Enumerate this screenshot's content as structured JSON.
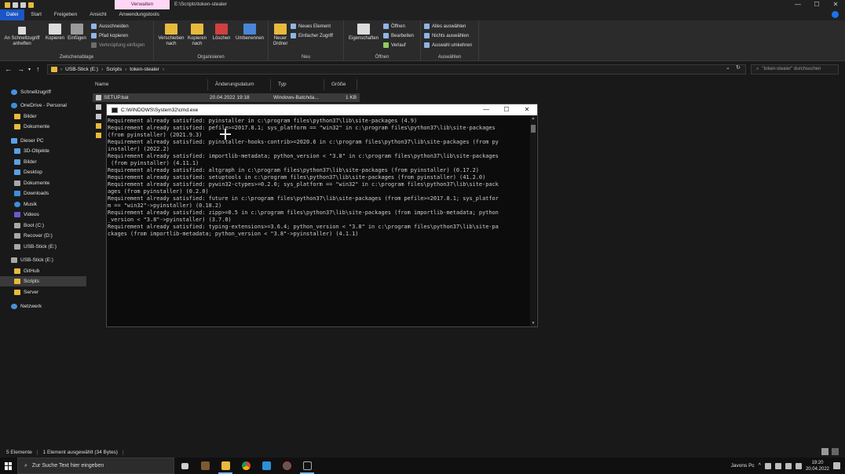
{
  "titlebar": {
    "context_tab": "Verwalten",
    "path": "E:\\Scripts\\token-stealer",
    "min": "—",
    "max": "☐",
    "close": "✕"
  },
  "ribbon_tabs": [
    "Datei",
    "Start",
    "Freigeben",
    "Ansicht",
    "Anwendungstools"
  ],
  "ribbon": {
    "clipboard": {
      "label": "Zwischenablage",
      "pin": "An Schnellzugriff anheften",
      "copy": "Kopieren",
      "paste": "Einfügen",
      "cut": "Ausschneiden",
      "copy_path": "Pfad kopieren",
      "paste_shortcut": "Verknüpfung einfügen"
    },
    "organize": {
      "label": "Organisieren",
      "move_to": "Verschieben nach",
      "copy_to": "Kopieren nach",
      "delete": "Löschen",
      "rename": "Umbenennen"
    },
    "new": {
      "label": "Neu",
      "new_folder": "Neuer Ordner",
      "new_item": "Neues Element",
      "easy_access": "Einfacher Zugriff"
    },
    "open": {
      "label": "Öffnen",
      "properties": "Eigenschaften",
      "open": "Öffnen",
      "edit": "Bearbeiten",
      "history": "Verlauf"
    },
    "select": {
      "label": "Auswählen",
      "select_all": "Alles auswählen",
      "select_none": "Nichts auswählen",
      "invert": "Auswahl umkehren"
    }
  },
  "address": {
    "crumbs": [
      "USB-Stick (E:)",
      "Scripts",
      "token-stealer"
    ],
    "search_placeholder": "\"token-stealer\" durchsuchen"
  },
  "nav": [
    {
      "label": "Schnellzugriff",
      "icon": "star-icon"
    },
    {
      "label": "OneDrive - Personal",
      "icon": "cloud-icon"
    },
    {
      "label": "Bilder",
      "icon": "folder-icon"
    },
    {
      "label": "Dokumente",
      "icon": "folder-icon"
    },
    {
      "label": "Dieser PC",
      "icon": "pc-icon"
    },
    {
      "label": "3D-Objekte",
      "icon": "cube-icon"
    },
    {
      "label": "Bilder",
      "icon": "pictures-icon"
    },
    {
      "label": "Desktop",
      "icon": "desktop-icon"
    },
    {
      "label": "Dokumente",
      "icon": "documents-icon"
    },
    {
      "label": "Downloads",
      "icon": "download-icon"
    },
    {
      "label": "Musik",
      "icon": "music-icon"
    },
    {
      "label": "Videos",
      "icon": "video-icon"
    },
    {
      "label": "Boot (C:)",
      "icon": "drive-icon"
    },
    {
      "label": "Recover (D:)",
      "icon": "drive-icon"
    },
    {
      "label": "USB-Stick (E:)",
      "icon": "usb-drive-icon"
    },
    {
      "label": "USB-Stick (E:)",
      "icon": "usb-drive-icon"
    },
    {
      "label": "GitHub",
      "icon": "folder-icon"
    },
    {
      "label": "Scripts",
      "icon": "folder-icon"
    },
    {
      "label": "Server",
      "icon": "folder-icon"
    },
    {
      "label": "Netzwerk",
      "icon": "network-icon"
    }
  ],
  "columns": [
    "Name",
    "Änderungsdatum",
    "Typ",
    "Größe"
  ],
  "files": [
    {
      "name": "SETUP.bat",
      "date": "20.04.2022 19:18",
      "type": "Windows-Batchda...",
      "size": "1 KB"
    }
  ],
  "cmd": {
    "title": "C:\\WINDOWS\\System32\\cmd.exe",
    "lines": [
      "Requirement already satisfied: pyinstaller in c:\\program files\\python37\\lib\\site-packages (4.9)",
      "Requirement already satisfied: pefile>=2017.8.1; sys_platform == \"win32\" in c:\\program files\\python37\\lib\\site-packages",
      "(from pyinstaller) (2021.9.3)",
      "Requirement already satisfied: pyinstaller-hooks-contrib>=2020.6 in c:\\program files\\python37\\lib\\site-packages (from py",
      "installer) (2022.2)",
      "Requirement already satisfied: importlib-metadata; python_version < \"3.8\" in c:\\program files\\python37\\lib\\site-packages",
      " (from pyinstaller) (4.11.1)",
      "Requirement already satisfied: altgraph in c:\\program files\\python37\\lib\\site-packages (from pyinstaller) (0.17.2)",
      "Requirement already satisfied: setuptools in c:\\program files\\python37\\lib\\site-packages (from pyinstaller) (41.2.0)",
      "Requirement already satisfied: pywin32-ctypes>=0.2.0; sys_platform == \"win32\" in c:\\program files\\python37\\lib\\site-pack",
      "ages (from pyinstaller) (0.2.0)",
      "Requirement already satisfied: future in c:\\program files\\python37\\lib\\site-packages (from pefile>=2017.8.1; sys_platfor",
      "m == \"win32\"->pyinstaller) (0.18.2)",
      "Requirement already satisfied: zipp>=0.5 in c:\\program files\\python37\\lib\\site-packages (from importlib-metadata; python",
      "_version < \"3.8\"->pyinstaller) (3.7.0)",
      "Requirement already satisfied: typing-extensions>=3.6.4; python_version < \"3.8\" in c:\\program files\\python37\\lib\\site-pa",
      "ckages (from importlib-metadata; python_version < \"3.8\"->pyinstaller) (4.1.1)"
    ]
  },
  "status": {
    "count": "5 Elemente",
    "selection": "1 Element ausgewählt (34 Bytes)"
  },
  "taskbar": {
    "search_placeholder": "Zur Suche Text hier eingeben",
    "user": "Javons Pc",
    "time": "19:20",
    "date": "20.04.2022"
  },
  "colors": {
    "accent": "#1a56c4",
    "context_tab": "#ffd7f5",
    "folder": "#e8b93c"
  }
}
